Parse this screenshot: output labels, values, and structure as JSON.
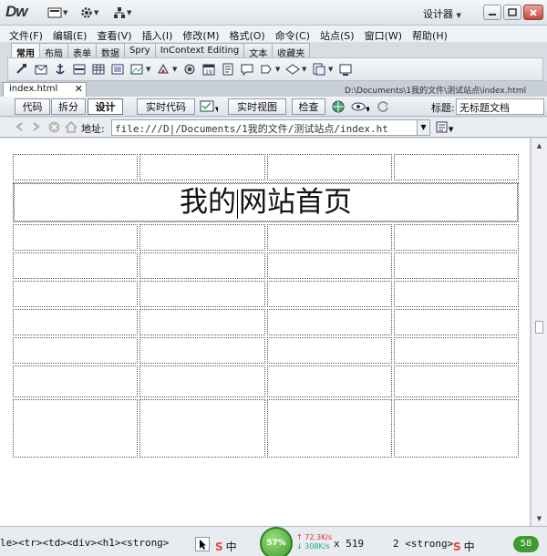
{
  "app": {
    "logo": "Dw",
    "workspace": "设计器"
  },
  "menu": [
    "文件(F)",
    "编辑(E)",
    "查看(V)",
    "插入(I)",
    "修改(M)",
    "格式(O)",
    "命令(C)",
    "站点(S)",
    "窗口(W)",
    "帮助(H)"
  ],
  "insert_tabs": [
    "常用",
    "布局",
    "表单",
    "数据",
    "Spry",
    "InContext Editing",
    "文本",
    "收藏夹"
  ],
  "doc": {
    "tab_label": "index.html",
    "path": "D:\\Documents\\1我的文件\\测试站点\\index.html"
  },
  "view_buttons": {
    "code": "代码",
    "split": "拆分",
    "design": "设计",
    "live_code": "实时代码",
    "live_view": "实时视图",
    "inspect": "检查"
  },
  "title_field": {
    "label": "标题:",
    "value": "无标题文档"
  },
  "address": {
    "label": "地址:",
    "value": "file:///D|/Documents/1我的文件/测试站点/index.ht"
  },
  "page": {
    "heading": [
      "我的",
      "网站首页"
    ]
  },
  "status": {
    "tag_selector": "le><tr><td><div><h1><strong>",
    "ime_label": "中",
    "speed_percent": "57%",
    "upload": "72.3K/s",
    "download": "308K/s",
    "window_size": "x 519",
    "encoding_part": "2 <strong>",
    "tray_badge": "58"
  }
}
